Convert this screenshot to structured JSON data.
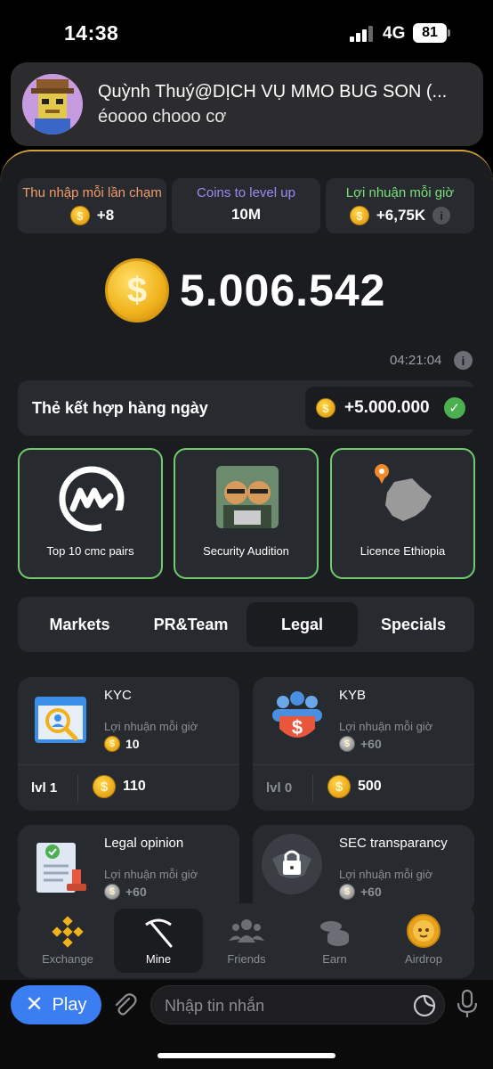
{
  "status": {
    "time": "14:38",
    "network": "4G",
    "battery": "81"
  },
  "notification": {
    "title": "Quỳnh Thuý@DỊCH VỤ MMO BUG SON (...",
    "message": "éoooo chooo cơ"
  },
  "stats": [
    {
      "label": "Thu nhập mỗi lần chạm",
      "value": "+8",
      "label_color": "#f39a6b"
    },
    {
      "label": "Coins to level up",
      "value": "10M",
      "label_color": "#9b8cf2"
    },
    {
      "label": "Lợi nhuận mỗi giờ",
      "value": "+6,75K",
      "label_color": "#7ddf7a"
    }
  ],
  "balance": "5.006.542",
  "timer": "04:21:04",
  "daily_combo": {
    "label": "Thẻ kết hợp hàng ngày",
    "reward": "+5.000.000"
  },
  "combo_cards": [
    {
      "label": "Top 10 cmc pairs",
      "icon": "coinmarketcap-icon"
    },
    {
      "label": "Security Audition",
      "icon": "hamsters-image"
    },
    {
      "label": "Licence Ethiopia",
      "icon": "ethiopia-map-icon"
    }
  ],
  "tabs": [
    "Markets",
    "PR&Team",
    "Legal",
    "Specials"
  ],
  "active_tab": "Legal",
  "profit_label": "Lợi nhuận mỗi giờ",
  "upgrades": [
    {
      "title": "KYC",
      "profit": "10",
      "level": "lvl 1",
      "cost": "110",
      "icon": "kyc-icon"
    },
    {
      "title": "KYB",
      "profit": "+60",
      "level": "lvl 0",
      "cost": "500",
      "icon": "kyb-icon"
    },
    {
      "title": "Legal opinion",
      "profit": "+60",
      "icon": "legal-document-icon"
    },
    {
      "title": "SEC transparancy",
      "profit": "+60",
      "icon": "sec-seal-icon"
    }
  ],
  "nav": [
    {
      "label": "Exchange",
      "icon": "binance-icon"
    },
    {
      "label": "Mine",
      "icon": "pickaxe-icon"
    },
    {
      "label": "Friends",
      "icon": "friends-icon"
    },
    {
      "label": "Earn",
      "icon": "coins-stack-icon"
    },
    {
      "label": "Airdrop",
      "icon": "hamster-coin-icon"
    }
  ],
  "telegram": {
    "play_label": "Play",
    "input_placeholder": "Nhập tin nhắn"
  },
  "colors": {
    "accent_gold": "#f0b21c",
    "panel": "#272a2f",
    "background": "#1a1c20",
    "green_border": "#6fcb6b",
    "telegram_blue": "#3b7ef2"
  }
}
